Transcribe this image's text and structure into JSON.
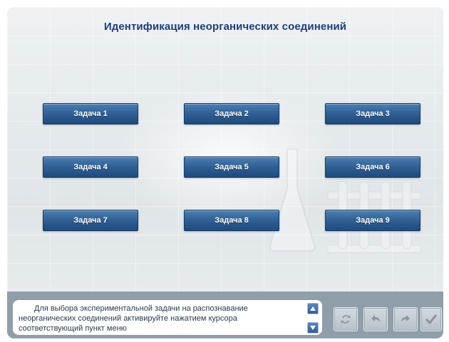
{
  "app": {
    "title": "Идентификация неорганических соединений"
  },
  "tasks": [
    {
      "label": "Задача 1"
    },
    {
      "label": "Задача 2"
    },
    {
      "label": "Задача 3"
    },
    {
      "label": "Задача 4"
    },
    {
      "label": "Задача 5"
    },
    {
      "label": "Задача 6"
    },
    {
      "label": "Задача 7"
    },
    {
      "label": "Задача 8"
    },
    {
      "label": "Задача 9"
    }
  ],
  "info": {
    "text": "Для выбора экспериментальной задачи на распознавание неорганических соединений активируйте нажатием  курсора соответствующий пункт меню"
  },
  "icons": {
    "scroll_up": "arrow-up-icon",
    "scroll_down": "arrow-down-icon",
    "refresh": "refresh-icon",
    "undo": "undo-icon",
    "redo": "redo-icon",
    "confirm": "check-icon"
  },
  "colors": {
    "title": "#1f3d7a",
    "button": "#2f5f94",
    "frame": "#8f9ea9"
  }
}
